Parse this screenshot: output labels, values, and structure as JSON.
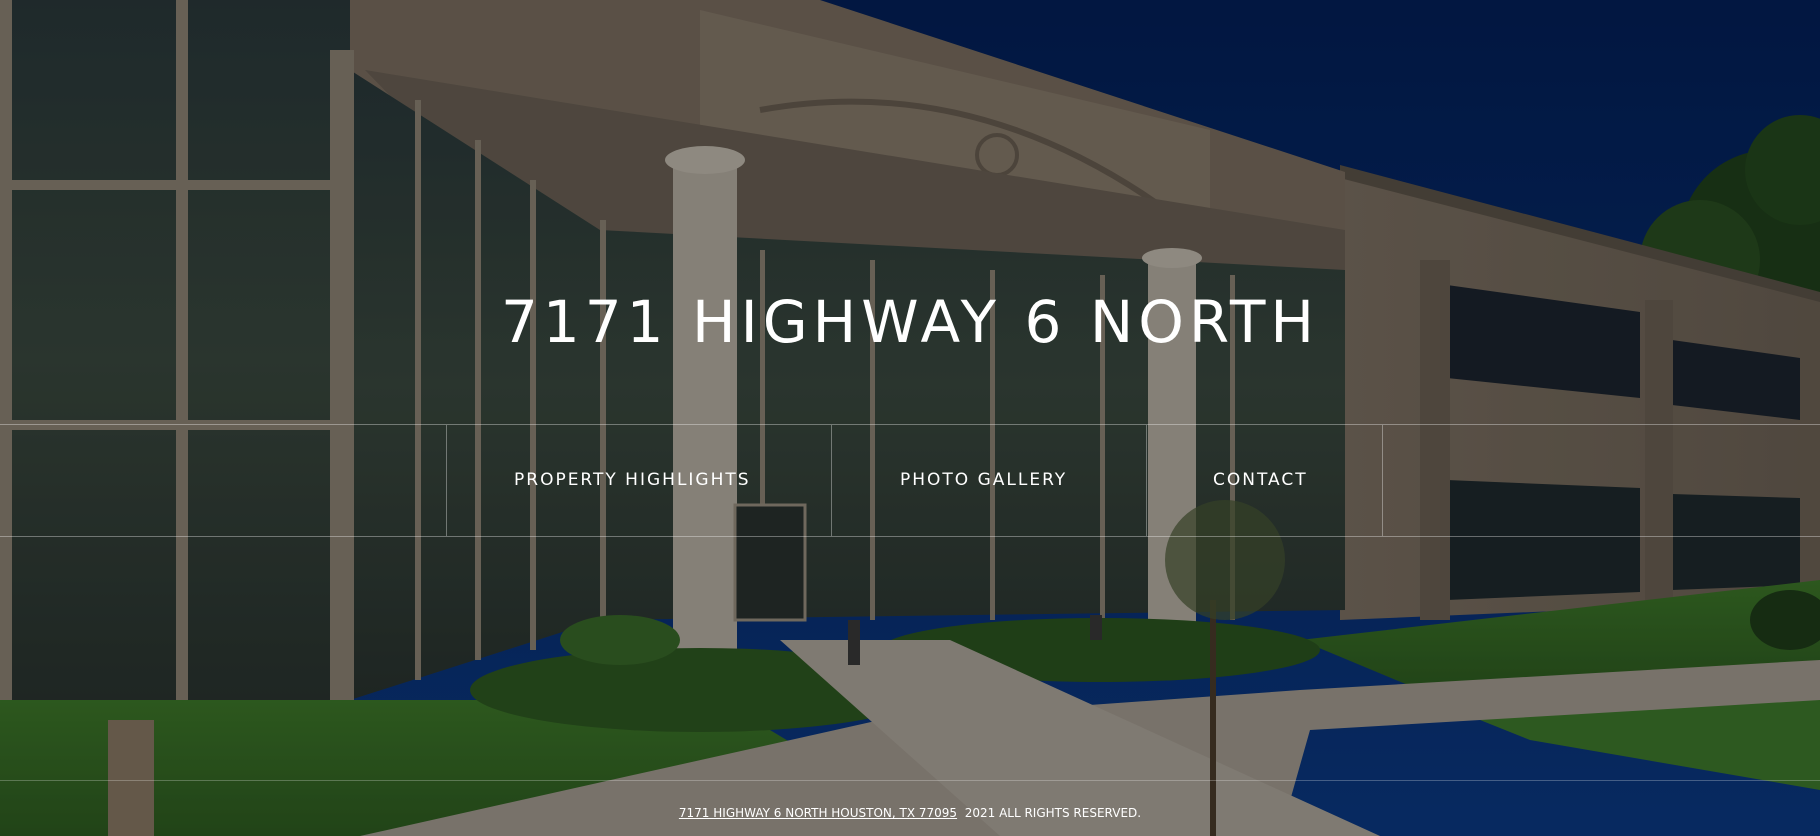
{
  "header": {
    "title": "7171 HIGHWAY 6 NORTH"
  },
  "nav": {
    "items": [
      {
        "label": "PROPERTY HIGHLIGHTS"
      },
      {
        "label": "PHOTO GALLERY"
      },
      {
        "label": "CONTACT"
      }
    ]
  },
  "footer": {
    "address_link": "7171 HIGHWAY 6 NORTH HOUSTON, TX 77095",
    "copyright": "2021 ALL RIGHTS RESERVED."
  },
  "colors": {
    "sky": "#0b2a66",
    "building": "#8a7d6e",
    "lawn": "#3f7a2e",
    "text": "#ffffff"
  }
}
